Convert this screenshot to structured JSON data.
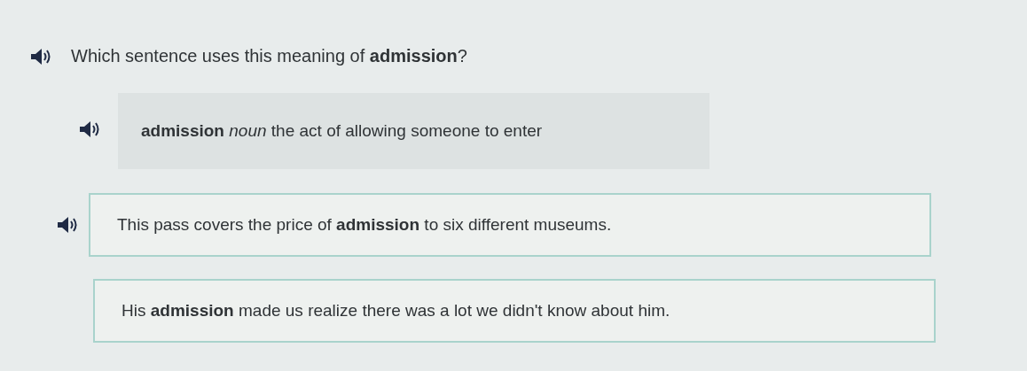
{
  "question": {
    "text": "Which sentence uses this meaning of **admission**?",
    "audio": true
  },
  "definition": {
    "word": "admission",
    "part_of_speech": "noun",
    "meaning": "the act of allowing someone to enter",
    "audio": true
  },
  "options": [
    {
      "text": "This pass covers the price of **admission** to six different museums.",
      "audio": true
    },
    {
      "text": "His **admission** made us realize there was a lot we didn't know about him.",
      "audio": false
    }
  ]
}
